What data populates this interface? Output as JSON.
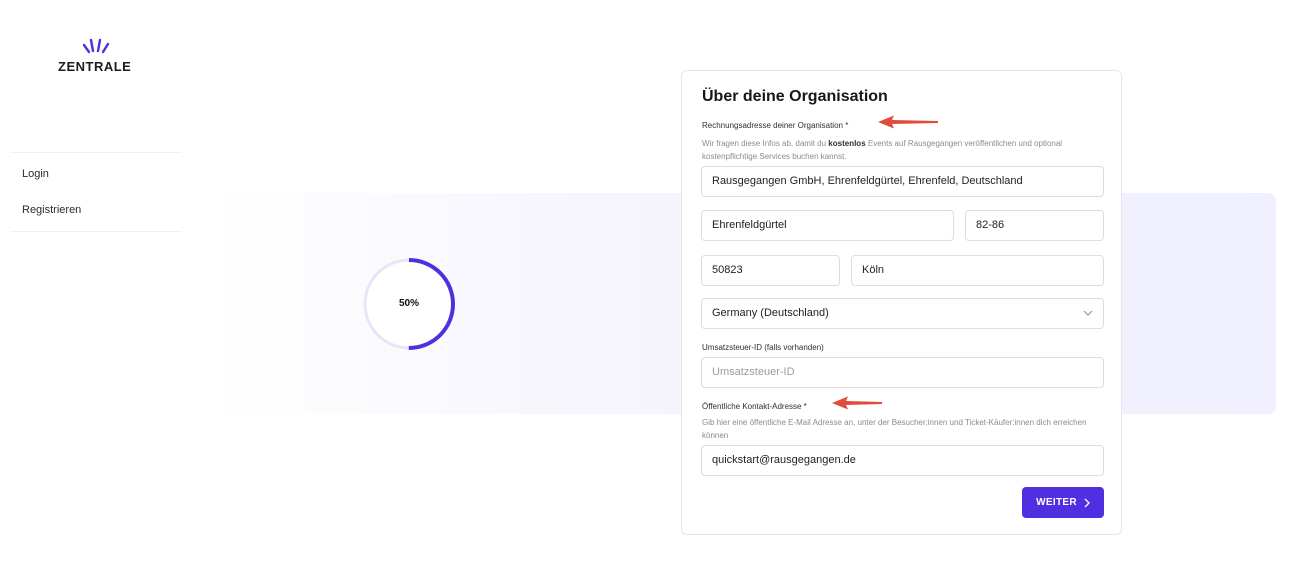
{
  "brand": {
    "name": "ZENTRALE",
    "accent": "#4f2fe0",
    "annotation_arrow_color": "#e04b3a"
  },
  "sidebar": {
    "items": [
      {
        "label": "Login"
      },
      {
        "label": "Registrieren"
      }
    ]
  },
  "progress": {
    "label": "50%",
    "value": 0.5
  },
  "form": {
    "title": "Über deine Organisation",
    "billing": {
      "label": "Rechnungsadresse deiner Organisation *",
      "hint_before": "Wir fragen diese Infos ab, damit du ",
      "hint_bold": "kostenlos",
      "hint_after": " Events auf Rausgegangen veröffentlichen und optional kostenpflichtige Services buchen kannst.",
      "search_value": "Rausgegangen GmbH, Ehrenfeldgürtel, Ehrenfeld, Deutschland",
      "street": "Ehrenfeldgürtel",
      "number": "82-86",
      "zip": "50823",
      "city": "Köln",
      "country": "Germany (Deutschland)"
    },
    "vat": {
      "label": "Umsatzsteuer-ID (falls vorhanden)",
      "placeholder": "Umsatzsteuer-ID"
    },
    "contact": {
      "label": "Öffentliche Kontakt-Adresse *",
      "hint": "Gib hier eine öffentliche E-Mail Adresse an, unter der Besucher:innen und Ticket-Käufer:innen dich erreichen können",
      "value": "quickstart@rausgegangen.de"
    },
    "next_button": "WEITER"
  }
}
